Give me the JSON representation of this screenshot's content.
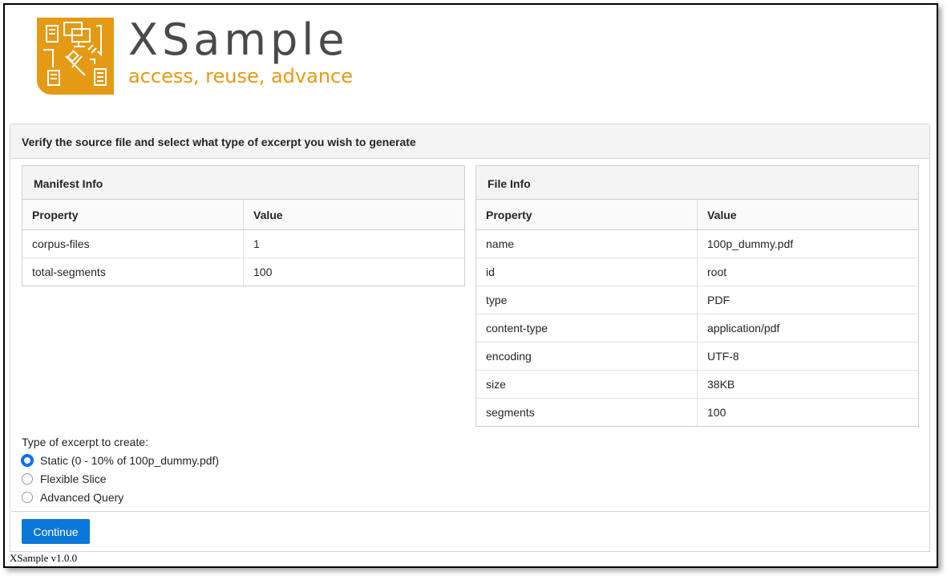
{
  "brand": {
    "title": "XSample",
    "tagline": "access, reuse, advance",
    "accent_color": "#e49a14",
    "logo_icon": "xsample-logo-icon"
  },
  "card": {
    "header": "Verify the source file and select what type of excerpt you wish to generate"
  },
  "manifest": {
    "title": "Manifest Info",
    "columns": [
      "Property",
      "Value"
    ],
    "rows": [
      {
        "property": "corpus-files",
        "value": "1"
      },
      {
        "property": "total-segments",
        "value": "100"
      }
    ]
  },
  "file_info": {
    "title": "File Info",
    "columns": [
      "Property",
      "Value"
    ],
    "rows": [
      {
        "property": "name",
        "value": "100p_dummy.pdf"
      },
      {
        "property": "id",
        "value": "root"
      },
      {
        "property": "type",
        "value": "PDF"
      },
      {
        "property": "content-type",
        "value": "application/pdf"
      },
      {
        "property": "encoding",
        "value": "UTF-8"
      },
      {
        "property": "size",
        "value": "38KB"
      },
      {
        "property": "segments",
        "value": "100"
      }
    ]
  },
  "excerpt": {
    "label": "Type of excerpt to create:",
    "options": [
      {
        "label": "Static (0 - 10% of 100p_dummy.pdf)",
        "selected": true
      },
      {
        "label": "Flexible Slice",
        "selected": false
      },
      {
        "label": "Advanced Query",
        "selected": false
      }
    ]
  },
  "footer": {
    "continue_label": "Continue",
    "button_color": "#0a78d8"
  },
  "version": "XSample v1.0.0"
}
